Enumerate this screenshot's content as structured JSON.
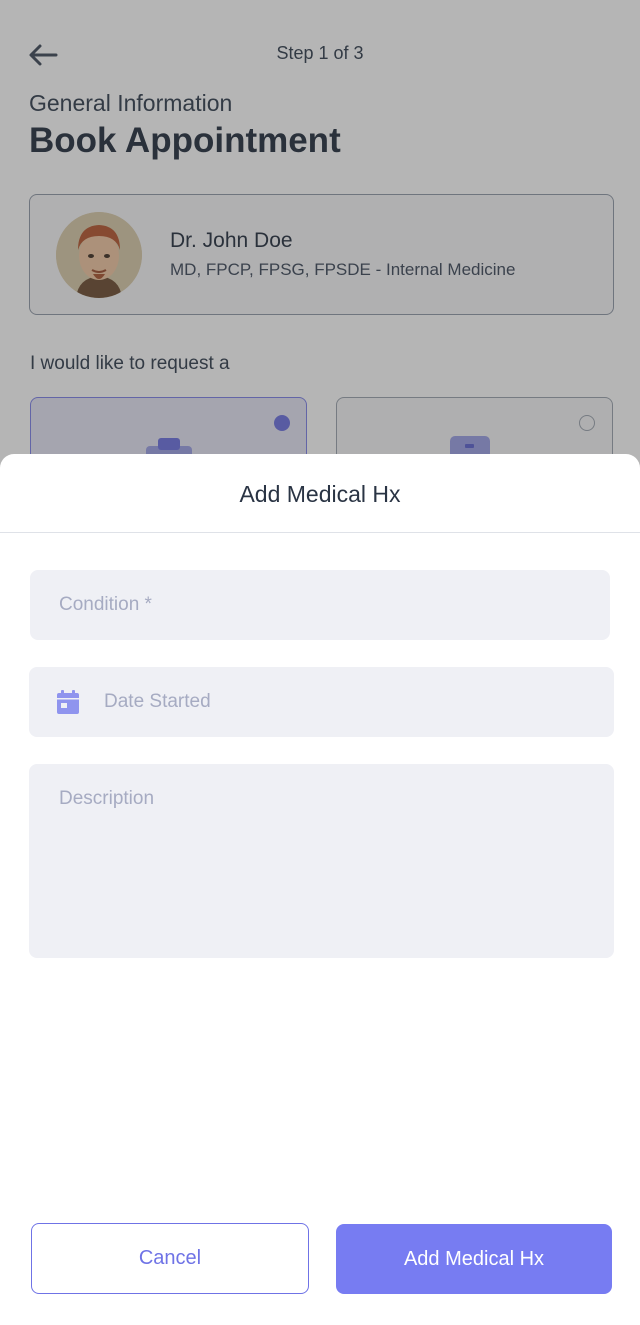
{
  "header": {
    "step": "Step 1 of 3",
    "subtitle": "General Information",
    "title": "Book Appointment"
  },
  "doctor": {
    "name": "Dr. John Doe",
    "specialty": "MD, FPCP, FPSG, FPSDE - Internal Medicine"
  },
  "request": {
    "label": "I would like to request a",
    "options": [
      {
        "selected": true,
        "icon": "clipboard-icon"
      },
      {
        "selected": false,
        "icon": "id-card-icon"
      }
    ]
  },
  "sheet": {
    "title": "Add Medical Hx",
    "condition_placeholder": "Condition *",
    "date_placeholder": "Date Started",
    "description_placeholder": "Description",
    "cancel_label": "Cancel",
    "submit_label": "Add Medical Hx"
  },
  "colors": {
    "accent": "#777cf2",
    "field_bg": "#eff0f5",
    "placeholder": "#a6abc2",
    "text_dark": "#2a3444"
  }
}
